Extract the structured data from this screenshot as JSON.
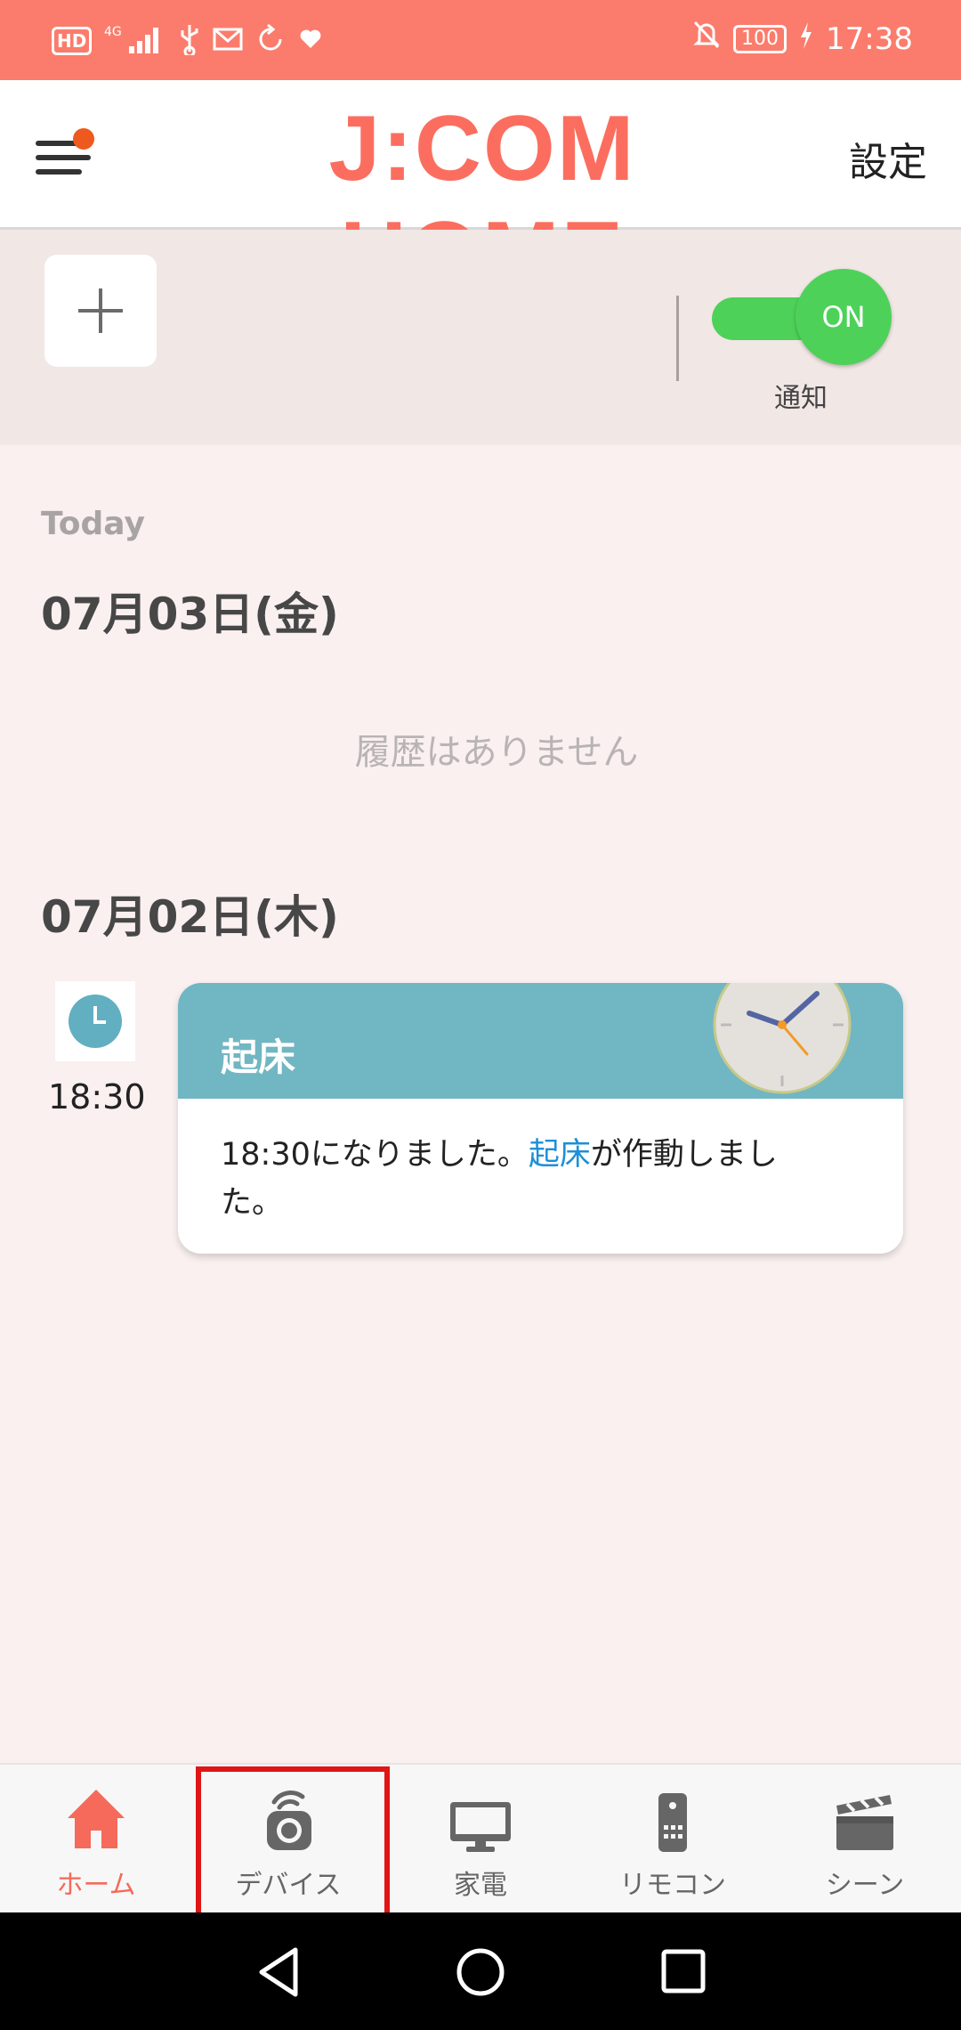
{
  "status_bar": {
    "hd": "HD",
    "network": "4G",
    "battery": "100",
    "time": "17:38"
  },
  "header": {
    "title": "J:COM HOME",
    "settings_label": "設定"
  },
  "top_panel": {
    "notification_toggle": {
      "state": "ON",
      "label": "通知"
    }
  },
  "content": {
    "today_label": "Today",
    "sections": [
      {
        "date": "07月03日(金)",
        "empty_text": "履歴はありません"
      },
      {
        "date": "07月02日(木)",
        "events": [
          {
            "time": "18:30",
            "title": "起床",
            "message_prefix": "18:30になりました。",
            "message_link": "起床",
            "message_suffix": "が作動しました。"
          }
        ]
      }
    ]
  },
  "bottom_nav": {
    "items": [
      {
        "label": "ホーム",
        "icon": "home-icon",
        "active": true
      },
      {
        "label": "デバイス",
        "icon": "camera-device-icon",
        "active": false
      },
      {
        "label": "家電",
        "icon": "monitor-icon",
        "active": false
      },
      {
        "label": "リモコン",
        "icon": "remote-control-icon",
        "active": false
      },
      {
        "label": "シーン",
        "icon": "clapperboard-icon",
        "active": false
      }
    ]
  },
  "colors": {
    "status_bar": "#fb7c6c",
    "brand": "#fb6e5f",
    "toggle_on": "#4ed159",
    "card_header": "#71b6c3",
    "link": "#1e8fd6",
    "highlight": "#e01515"
  }
}
